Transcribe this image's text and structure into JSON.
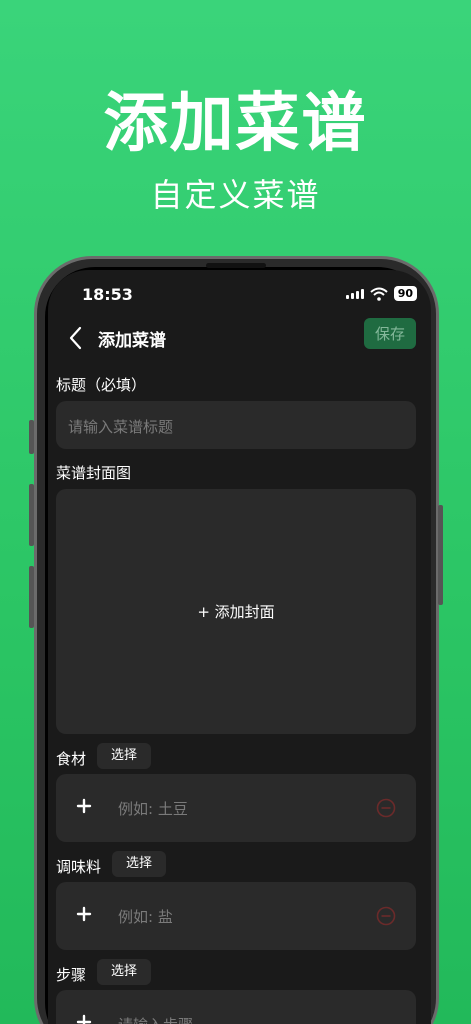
{
  "promo": {
    "title": "添加菜谱",
    "subtitle": "自定义菜谱"
  },
  "status": {
    "time": "18:53",
    "battery": "90"
  },
  "nav": {
    "title": "添加菜谱",
    "save_label": "保存"
  },
  "form": {
    "title_label": "标题（必填）",
    "title_placeholder": "请输入菜谱标题",
    "cover_label": "菜谱封面图",
    "cover_add": "+ 添加封面",
    "ingredients_label": "食材",
    "ingredients_select": "选择",
    "ingredients_placeholder": "例如: 土豆",
    "seasoning_label": "调味料",
    "seasoning_select": "选择",
    "seasoning_placeholder": "例如: 盐",
    "steps_label": "步骤",
    "steps_select": "选择",
    "steps_placeholder": "请输入步骤"
  },
  "colors": {
    "accent": "#2bc564",
    "save_bg": "#1f6b41",
    "remove_icon": "#6b2a2a"
  }
}
